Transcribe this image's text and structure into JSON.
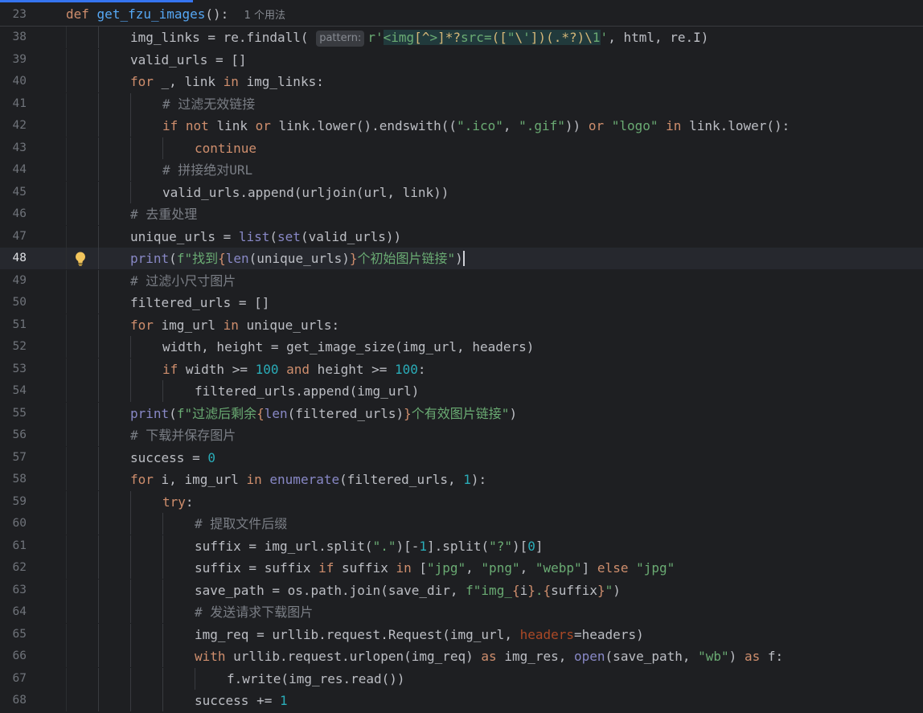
{
  "editor": {
    "sticky": {
      "line_number": "23",
      "def_kw": "def",
      "func_name": "get_fzu_images",
      "signature_rest": "():",
      "usage_hint": "1 个用法"
    },
    "current_line": "48",
    "pattern_hint": "pattern:",
    "lines": [
      {
        "n": "38",
        "indent": 2,
        "code": "img_links = re.findall( pattern: r'<img[^>]*?src=([\"\\'])(.*?)\\1', html, re.I)"
      },
      {
        "n": "39",
        "indent": 2,
        "code": "valid_urls = []"
      },
      {
        "n": "40",
        "indent": 2,
        "code": "for _, link in img_links:"
      },
      {
        "n": "41",
        "indent": 3,
        "code": "# 过滤无效链接"
      },
      {
        "n": "42",
        "indent": 3,
        "code": "if not link or link.lower().endswith((\".ico\", \".gif\")) or \"logo\" in link.lower():"
      },
      {
        "n": "43",
        "indent": 4,
        "code": "continue"
      },
      {
        "n": "44",
        "indent": 3,
        "code": "# 拼接绝对URL"
      },
      {
        "n": "45",
        "indent": 3,
        "code": "valid_urls.append(urljoin(url, link))"
      },
      {
        "n": "46",
        "indent": 2,
        "code": "# 去重处理"
      },
      {
        "n": "47",
        "indent": 2,
        "code": "unique_urls = list(set(valid_urls))"
      },
      {
        "n": "48",
        "indent": 2,
        "code": "print(f\"找到{len(unique_urls)}个初始图片链接\")"
      },
      {
        "n": "49",
        "indent": 2,
        "code": "# 过滤小尺寸图片"
      },
      {
        "n": "50",
        "indent": 2,
        "code": "filtered_urls = []"
      },
      {
        "n": "51",
        "indent": 2,
        "code": "for img_url in unique_urls:"
      },
      {
        "n": "52",
        "indent": 3,
        "code": "width, height = get_image_size(img_url, headers)"
      },
      {
        "n": "53",
        "indent": 3,
        "code": "if width >= 100 and height >= 100:"
      },
      {
        "n": "54",
        "indent": 4,
        "code": "filtered_urls.append(img_url)"
      },
      {
        "n": "55",
        "indent": 2,
        "code": "print(f\"过滤后剩余{len(filtered_urls)}个有效图片链接\")"
      },
      {
        "n": "56",
        "indent": 2,
        "code": "# 下载并保存图片"
      },
      {
        "n": "57",
        "indent": 2,
        "code": "success = 0"
      },
      {
        "n": "58",
        "indent": 2,
        "code": "for i, img_url in enumerate(filtered_urls, 1):"
      },
      {
        "n": "59",
        "indent": 3,
        "code": "try:"
      },
      {
        "n": "60",
        "indent": 4,
        "code": "# 提取文件后缀"
      },
      {
        "n": "61",
        "indent": 4,
        "code": "suffix = img_url.split(\".\")[-1].split(\"?\")[0]"
      },
      {
        "n": "62",
        "indent": 4,
        "code": "suffix = suffix if suffix in [\"jpg\", \"png\", \"webp\"] else \"jpg\""
      },
      {
        "n": "63",
        "indent": 4,
        "code": "save_path = os.path.join(save_dir, f\"img_{i}.{suffix}\")"
      },
      {
        "n": "64",
        "indent": 4,
        "code": "# 发送请求下载图片"
      },
      {
        "n": "65",
        "indent": 4,
        "code": "img_req = urllib.request.Request(img_url, headers=headers)"
      },
      {
        "n": "66",
        "indent": 4,
        "code": "with urllib.request.urlopen(img_req) as img_res, open(save_path, \"wb\") as f:"
      },
      {
        "n": "67",
        "indent": 5,
        "code": "f.write(img_res.read())"
      },
      {
        "n": "68",
        "indent": 4,
        "code": "success += 1"
      }
    ]
  },
  "colors": {
    "background": "#1e1f22",
    "current_line": "#26282e",
    "keyword": "#cf8e6d",
    "function": "#56a8f5",
    "builtin": "#8888c6",
    "string": "#6aab73",
    "number": "#2aacb8",
    "comment": "#7a7e85",
    "param": "#aa4926",
    "regex": "#d5b778",
    "accent": "#3574f0"
  },
  "icons": {
    "intention": "lightbulb-icon"
  }
}
